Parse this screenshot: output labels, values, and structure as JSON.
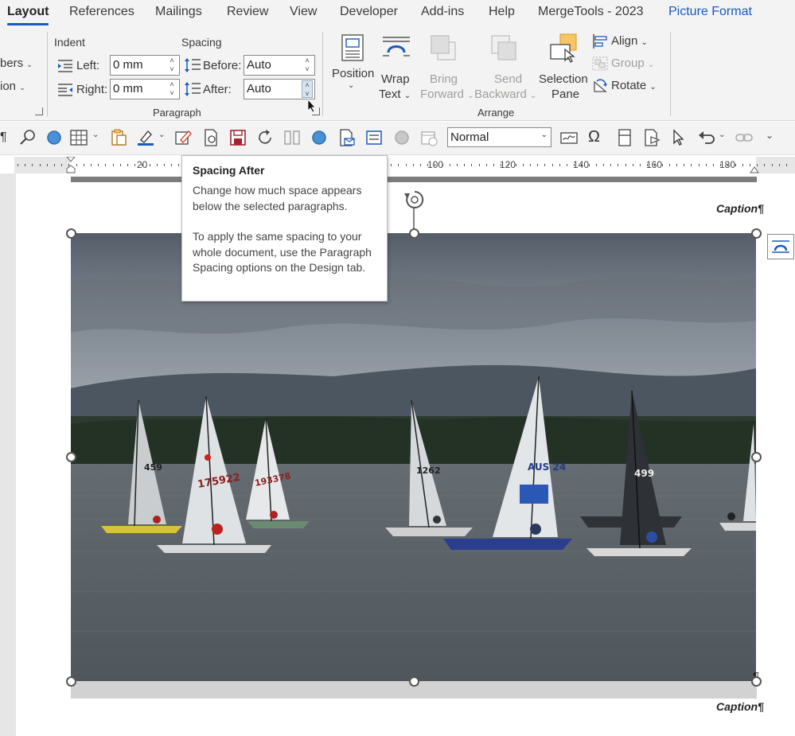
{
  "ribbon_tabs": [
    {
      "label": "Layout",
      "active": true
    },
    {
      "label": "References"
    },
    {
      "label": "Mailings"
    },
    {
      "label": "Review"
    },
    {
      "label": "View"
    },
    {
      "label": "Developer"
    },
    {
      "label": "Add-ins"
    },
    {
      "label": "Help"
    },
    {
      "label": "MergeTools - 2023"
    },
    {
      "label": "Picture Format",
      "contextual": true
    }
  ],
  "paragraph_group": {
    "cut_left_1": "bers",
    "cut_left_2": "ion",
    "indent_header": "Indent",
    "spacing_header": "Spacing",
    "left_label": "Left:",
    "left_value": "0 mm",
    "right_label": "Right:",
    "right_value": "0 mm",
    "before_label": "Before:",
    "before_value": "Auto",
    "after_label": "After:",
    "after_value": "Auto",
    "group_label": "Paragraph"
  },
  "arrange_group": {
    "position": "Position",
    "wrap_line1": "Wrap",
    "wrap_line2": "Text",
    "bring_line1": "Bring",
    "bring_line2": "Forward",
    "send_line1": "Send",
    "send_line2": "Backward",
    "selection_line1": "Selection",
    "selection_line2": "Pane",
    "align": "Align",
    "group": "Group",
    "rotate": "Rotate",
    "group_label": "Arrange"
  },
  "toolbar": {
    "style_value": "Normal"
  },
  "ruler": {
    "labels": [
      "20",
      "100",
      "120",
      "140",
      "160",
      "180"
    ]
  },
  "tooltip": {
    "title": "Spacing After",
    "body1": "Change how much space appears below the selected paragraphs.",
    "body2": "To apply the same spacing to your whole document, use the Paragraph Spacing options on the Design tab."
  },
  "document": {
    "caption_top": "Caption¶",
    "caption_bottom": "Caption¶",
    "pilcrow": "¶",
    "sail_numbers": [
      "459",
      "175922",
      "193378",
      "1262",
      "AUS 24",
      "499"
    ]
  },
  "colors": {
    "accent": "#185abd",
    "ribbon_bg": "#f3f3f3"
  }
}
